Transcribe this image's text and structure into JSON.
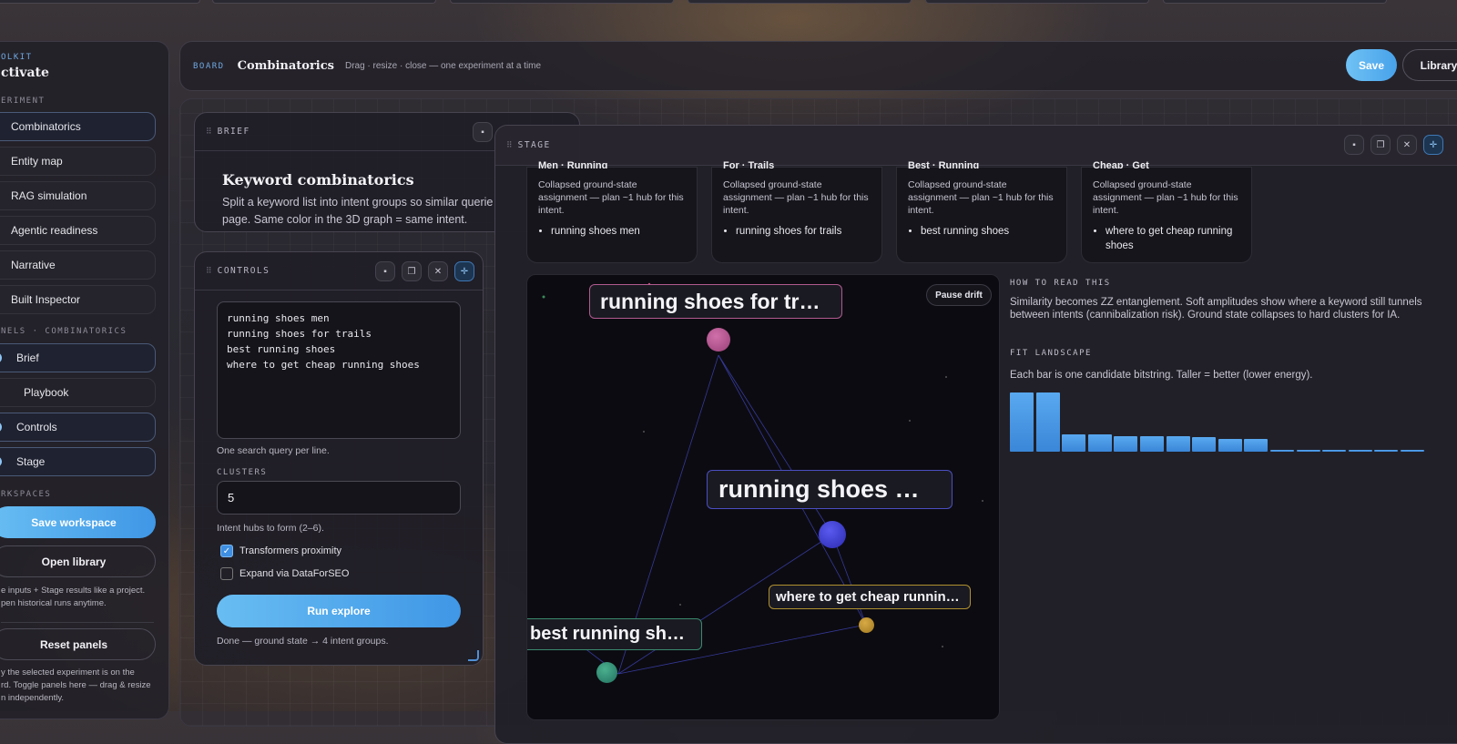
{
  "sidebar": {
    "overline": "OLKIT",
    "title": "ctivate",
    "section_experiment": "ERIMENT",
    "experiments": [
      "Combinatorics",
      "Entity map",
      "RAG simulation",
      "Agentic readiness",
      "Narrative",
      "Built Inspector"
    ],
    "section_panels": "NELS · COMBINATORICS",
    "panels": [
      "Brief",
      "Playbook",
      "Controls",
      "Stage"
    ],
    "section_workspaces": "RKSPACES",
    "save_workspace": "Save workspace",
    "open_library": "Open library",
    "workspace_note_1": "e inputs + Stage results like a project.",
    "workspace_note_2": "pen historical runs anytime.",
    "reset_panels": "Reset panels",
    "panels_note_1": "y the selected experiment is on the",
    "panels_note_2": "rd. Toggle panels here — drag & resize",
    "panels_note_3": "n independently."
  },
  "board": {
    "tag": "BOARD",
    "title": "Combinatorics",
    "subtitle": "Drag · resize · close — one experiment at a time",
    "save": "Save",
    "library": "Library"
  },
  "brief": {
    "header": "BRIEF",
    "heading": "Keyword combinatorics",
    "line1": "Split a keyword list into intent groups so similar querie",
    "line2": "page. Same color in the 3D graph = same intent."
  },
  "controls": {
    "header": "CONTROLS",
    "keywords": "running shoes men\nrunning shoes for trails\nbest running shoes\nwhere to get cheap running shoes",
    "keywords_hint": "One search query per line.",
    "clusters_label": "CLUSTERS",
    "clusters_value": "5",
    "clusters_hint": "Intent hubs to form (2–6).",
    "opt_transformers": "Transformers proximity",
    "opt_transformers_checked": true,
    "opt_expand": "Expand via DataForSEO",
    "opt_expand_checked": false,
    "run_button": "Run explore",
    "status": "Done — ground state → 4 intent groups."
  },
  "stage": {
    "header": "STAGE",
    "cards": [
      {
        "title_cut": "Men · Running",
        "body": "Collapsed ground-state assignment — plan ~1 hub for this intent.",
        "items": [
          "running shoes men"
        ]
      },
      {
        "title_cut": "For · Trails",
        "body": "Collapsed ground-state assignment — plan ~1 hub for this intent.",
        "items": [
          "running shoes for trails"
        ]
      },
      {
        "title_cut": "Best · Running",
        "body": "Collapsed ground-state assignment — plan ~1 hub for this intent.",
        "items": [
          "best running shoes"
        ]
      },
      {
        "title_cut": "Cheap · Get",
        "body": "Collapsed ground-state assignment — plan ~1 hub for this intent.",
        "items": [
          "where to get cheap running shoes"
        ]
      }
    ],
    "graph": {
      "pause": "Pause drift",
      "labels": [
        "running shoes for trails",
        "running shoes men",
        "where to get cheap runnin…",
        "best running shoes"
      ],
      "node_colors": [
        "#b0508f",
        "#3535c8",
        "#b08a30",
        "#2f8a70"
      ]
    },
    "how_title": "HOW TO READ THIS",
    "how_text": "Similarity becomes ZZ entanglement. Soft amplitudes show where a keyword still tunnels between intents (cannibalization risk). Ground state collapses to hard clusters for IA.",
    "fit_title": "FIT LANDSCAPE",
    "fit_text": "Each bar is one candidate bitstring. Taller = better (lower energy).",
    "fit_bars": [
      1.0,
      1.0,
      0.3,
      0.3,
      0.26,
      0.26,
      0.26,
      0.24,
      0.21,
      0.21,
      0.03,
      0.03,
      0.03,
      0.03,
      0.03,
      0.03
    ]
  }
}
